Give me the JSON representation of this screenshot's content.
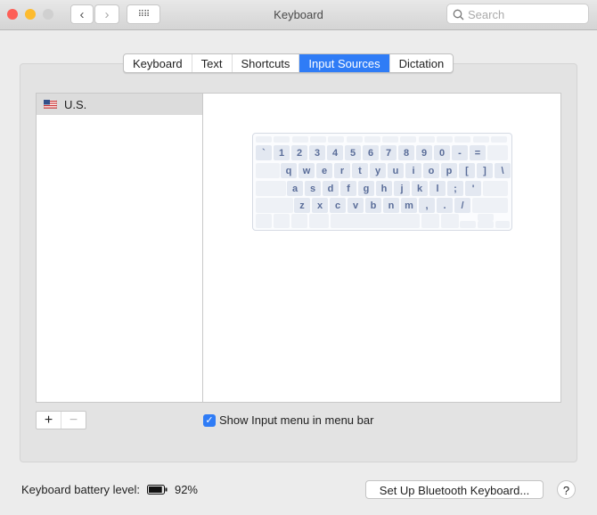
{
  "window": {
    "title": "Keyboard",
    "search_placeholder": "Search"
  },
  "tabs": [
    {
      "label": "Keyboard"
    },
    {
      "label": "Text"
    },
    {
      "label": "Shortcuts"
    },
    {
      "label": "Input Sources",
      "active": true
    },
    {
      "label": "Dictation"
    }
  ],
  "sources": [
    {
      "label": "U.S.",
      "icon": "us-flag-icon"
    }
  ],
  "keyboard_rows": [
    [
      "`",
      "1",
      "2",
      "3",
      "4",
      "5",
      "6",
      "7",
      "8",
      "9",
      "0",
      "-",
      "="
    ],
    [
      "q",
      "w",
      "e",
      "r",
      "t",
      "y",
      "u",
      "i",
      "o",
      "p",
      "[",
      "]",
      "\\"
    ],
    [
      "a",
      "s",
      "d",
      "f",
      "g",
      "h",
      "j",
      "k",
      "l",
      ";",
      "'"
    ],
    [
      "z",
      "x",
      "c",
      "v",
      "b",
      "n",
      "m",
      ",",
      ".",
      "/"
    ]
  ],
  "add_label": "+",
  "remove_label": "−",
  "show_input_menu": {
    "label": "Show Input menu in menu bar",
    "checked": true
  },
  "battery": {
    "label": "Keyboard battery level:",
    "value": "92%",
    "percent": 92
  },
  "bluetooth_button": "Set Up Bluetooth Keyboard...",
  "help": "?"
}
